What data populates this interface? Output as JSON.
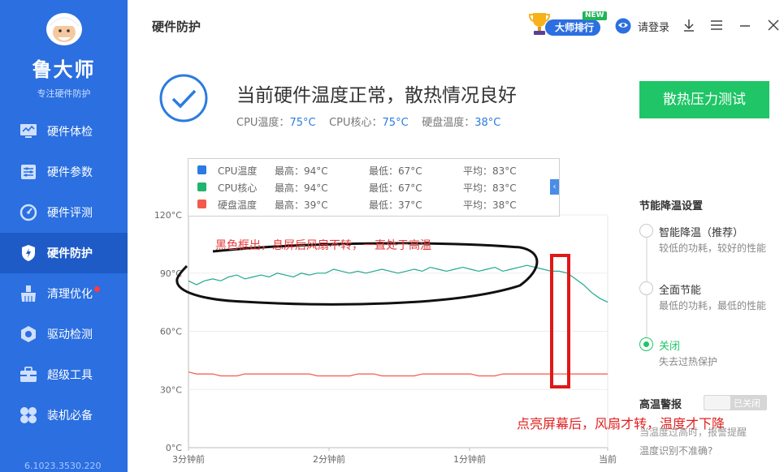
{
  "sidebar": {
    "app_name": "鲁大师",
    "slogan": "专注硬件防护",
    "version": "6.1023.3530.220",
    "items": [
      {
        "label": "硬件体检",
        "icon": "monitor-icon"
      },
      {
        "label": "硬件参数",
        "icon": "sliders-icon"
      },
      {
        "label": "硬件评测",
        "icon": "gauge-icon"
      },
      {
        "label": "硬件防护",
        "icon": "shield-icon",
        "active": true
      },
      {
        "label": "清理优化",
        "icon": "broom-icon",
        "badge": true
      },
      {
        "label": "驱动检测",
        "icon": "hexagon-icon"
      },
      {
        "label": "超级工具",
        "icon": "toolbox-icon"
      },
      {
        "label": "装机必备",
        "icon": "clover-icon"
      }
    ]
  },
  "header": {
    "title": "硬件防护",
    "master_label": "大师排行",
    "new_tag": "NEW",
    "login_label": "请登录"
  },
  "status": {
    "headline": "当前硬件温度正常，散热情况良好",
    "cpu_label": "CPU温度：",
    "cpu_value": "75°C",
    "core_label": "CPU核心：",
    "core_value": "75°C",
    "disk_label": "硬盘温度：",
    "disk_value": "38°C",
    "stress_button": "散热压力测试"
  },
  "legend": [
    {
      "name": "CPU温度",
      "max": "最高：94°C",
      "min": "最低：67°C",
      "avg": "平均：83°C",
      "color": "#2b7be0"
    },
    {
      "name": "CPU核心",
      "max": "最高：94°C",
      "min": "最低：67°C",
      "avg": "平均：83°C",
      "color": "#20b46e"
    },
    {
      "name": "硬盘温度",
      "max": "最高：39°C",
      "min": "最低：37°C",
      "avg": "平均：38°C",
      "color": "#f25a4a"
    }
  ],
  "chart_data": {
    "type": "line",
    "y_ticks": [
      "0°C",
      "30°C",
      "60°C",
      "90°C",
      "120°C"
    ],
    "ylim": [
      0,
      120
    ],
    "x_ticks": [
      "3分钟前",
      "2分钟前",
      "1分钟前",
      "当前"
    ],
    "series": [
      {
        "name": "CPU核心",
        "color": "#20a890",
        "values": [
          86,
          84,
          86,
          87,
          86,
          88,
          89,
          87,
          88,
          89,
          88,
          90,
          89,
          88,
          90,
          89,
          90,
          90,
          92,
          91,
          90,
          91,
          90,
          91,
          92,
          91,
          90,
          91,
          92,
          91,
          93,
          92,
          91,
          92,
          93,
          92,
          91,
          92,
          93,
          91,
          92,
          93,
          94,
          93,
          92,
          91,
          91,
          90,
          87,
          84,
          80,
          77,
          75
        ]
      },
      {
        "name": "硬盘温度",
        "color": "#f25a4a",
        "values": [
          39,
          38,
          38,
          38,
          37,
          37,
          37,
          38,
          38,
          38,
          38,
          38,
          38,
          38,
          38,
          38,
          37,
          37,
          37,
          37,
          37,
          38,
          38,
          38,
          37,
          37,
          37,
          37,
          37,
          38,
          38,
          38,
          38,
          38,
          38,
          38,
          37,
          37,
          37,
          38,
          38,
          38,
          38,
          38,
          38,
          38,
          38,
          38,
          38,
          38,
          38,
          38,
          38
        ]
      }
    ]
  },
  "annotations": {
    "top_note": "黑色框出，息屏后风扇不转，一直处于高温",
    "bottom_note": "点亮屏幕后，风扇才转，温度才下降"
  },
  "right_panel": {
    "title": "节能降温设置",
    "options": [
      {
        "label": "智能降温（推荐）",
        "desc": "较低的功耗，较好的性能",
        "selected": false
      },
      {
        "label": "全面节能",
        "desc": "最低的功耗，最低的性能",
        "selected": false
      },
      {
        "label": "关闭",
        "desc": "失去过热保护",
        "selected": true
      }
    ],
    "alarm_title": "高温警报",
    "alarm_toggle": "已关闭",
    "alarm_desc": "当温度过高时，报警提醒",
    "alarm_link": "温度识别不准确?"
  }
}
